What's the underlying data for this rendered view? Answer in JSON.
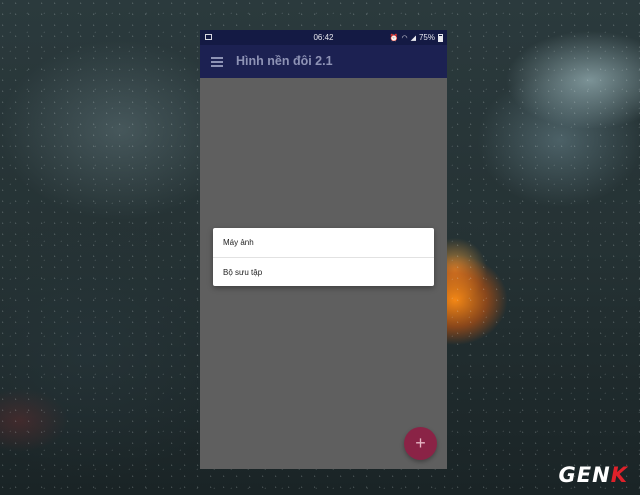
{
  "status_bar": {
    "time": "06:42",
    "battery": "75%",
    "icons": [
      "image-icon",
      "alarm-icon",
      "wifi-icon",
      "signal-icon",
      "battery-icon"
    ]
  },
  "app_bar": {
    "title": "Hình nền đôi 2.1",
    "menu_icon": "hamburger-menu-icon"
  },
  "dialog": {
    "options": [
      "Máy ảnh",
      "Bộ sưu tập"
    ]
  },
  "fab": {
    "label": "+",
    "color": "#8a2346"
  },
  "watermark": {
    "text_main": "GEN",
    "text_accent": "K"
  },
  "colors": {
    "status_bar": "#141a44",
    "app_bar": "#1c2152",
    "scrim": "#5f5f5f"
  }
}
